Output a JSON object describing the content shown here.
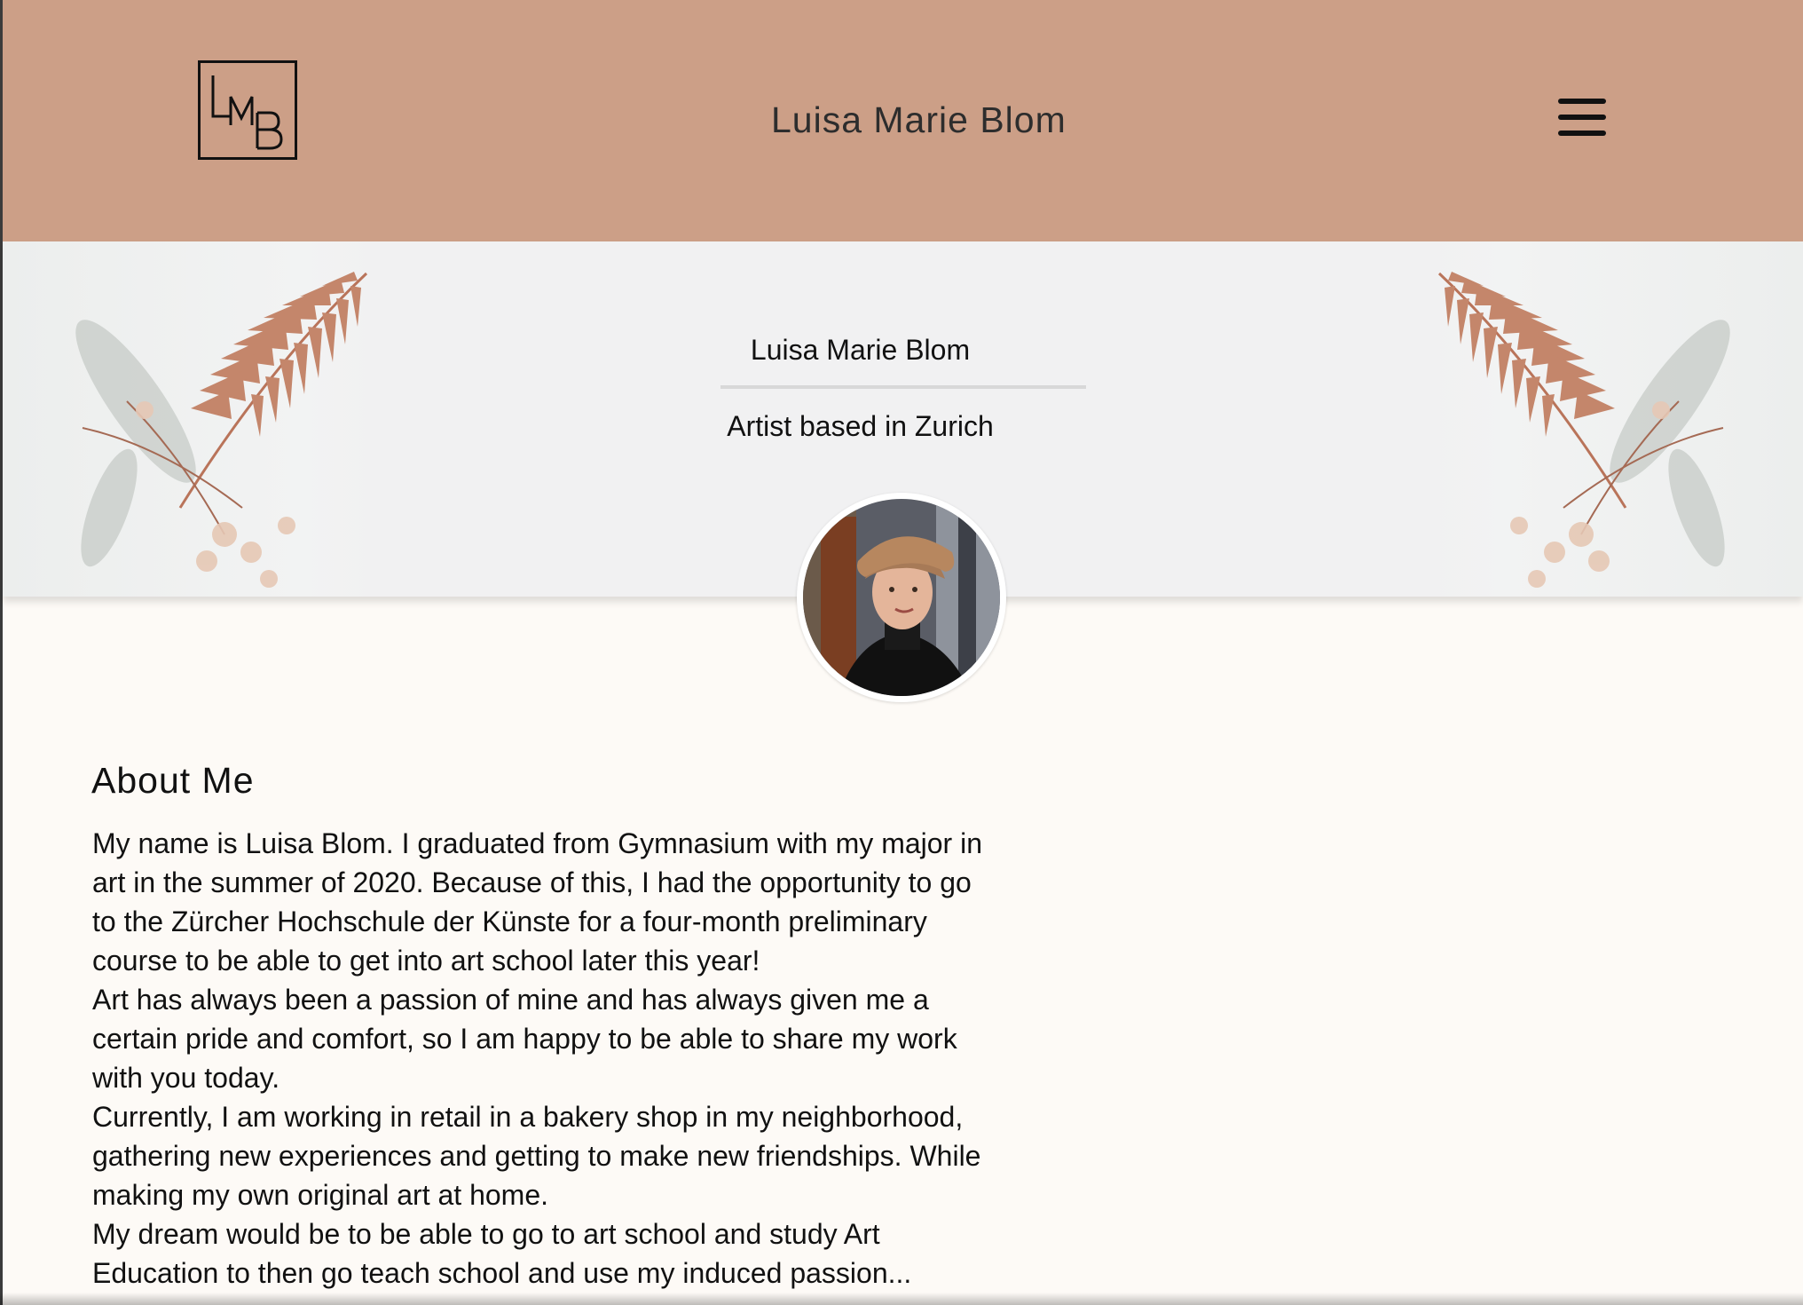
{
  "header": {
    "logo_text": "LMB",
    "title": "Luisa Marie Blom",
    "menu_icon": "hamburger-menu-icon",
    "background_color": "#cc9f87"
  },
  "hero": {
    "name": "Luisa Marie Blom",
    "subtitle": "Artist based in Zurich",
    "decoration_icon": "fern-flower-icon"
  },
  "avatar": {
    "icon": "profile-photo"
  },
  "about": {
    "heading": "About Me",
    "paragraphs": [
      "My name is Luisa Blom. I graduated from Gymnasium with my major in art in the summer of 2020. Because of this, I had the opportunity to go to the Zürcher Hochschule der Künste for a four-month preliminary course to be able to get into art school later this year!",
      "Art has always been a passion of mine and has always given me a certain pride and comfort, so I am happy to be able to share my work with you today.",
      "Currently, I am working in retail in a bakery shop in my neighborhood, gathering new experiences and getting to make new friendships. While making my own original art at home.",
      "My dream would be to be able to go to art school and study Art Education to then go teach school and use my induced passion..."
    ]
  }
}
